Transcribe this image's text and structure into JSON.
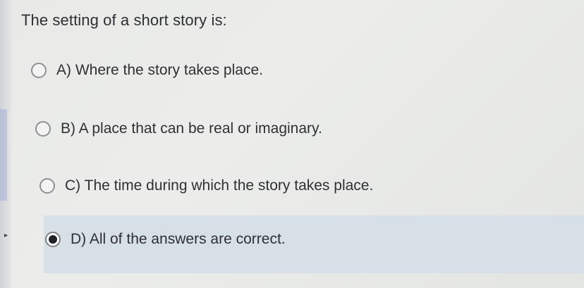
{
  "question": {
    "text": "The setting of a short story is:"
  },
  "options": [
    {
      "label": "A) Where the story takes place.",
      "selected": false
    },
    {
      "label": "B) A place that can be real or imaginary.",
      "selected": false
    },
    {
      "label": "C) The time during which the story takes place.",
      "selected": false
    },
    {
      "label": "D) All of the answers are correct.",
      "selected": true
    }
  ],
  "colors": {
    "selected_highlight": "#d6e0e6",
    "text": "#2f3034",
    "radio_border": "#8d9196",
    "radio_dot": "#1f2226"
  },
  "icons": {
    "rail_caret": "caret-right-icon"
  }
}
